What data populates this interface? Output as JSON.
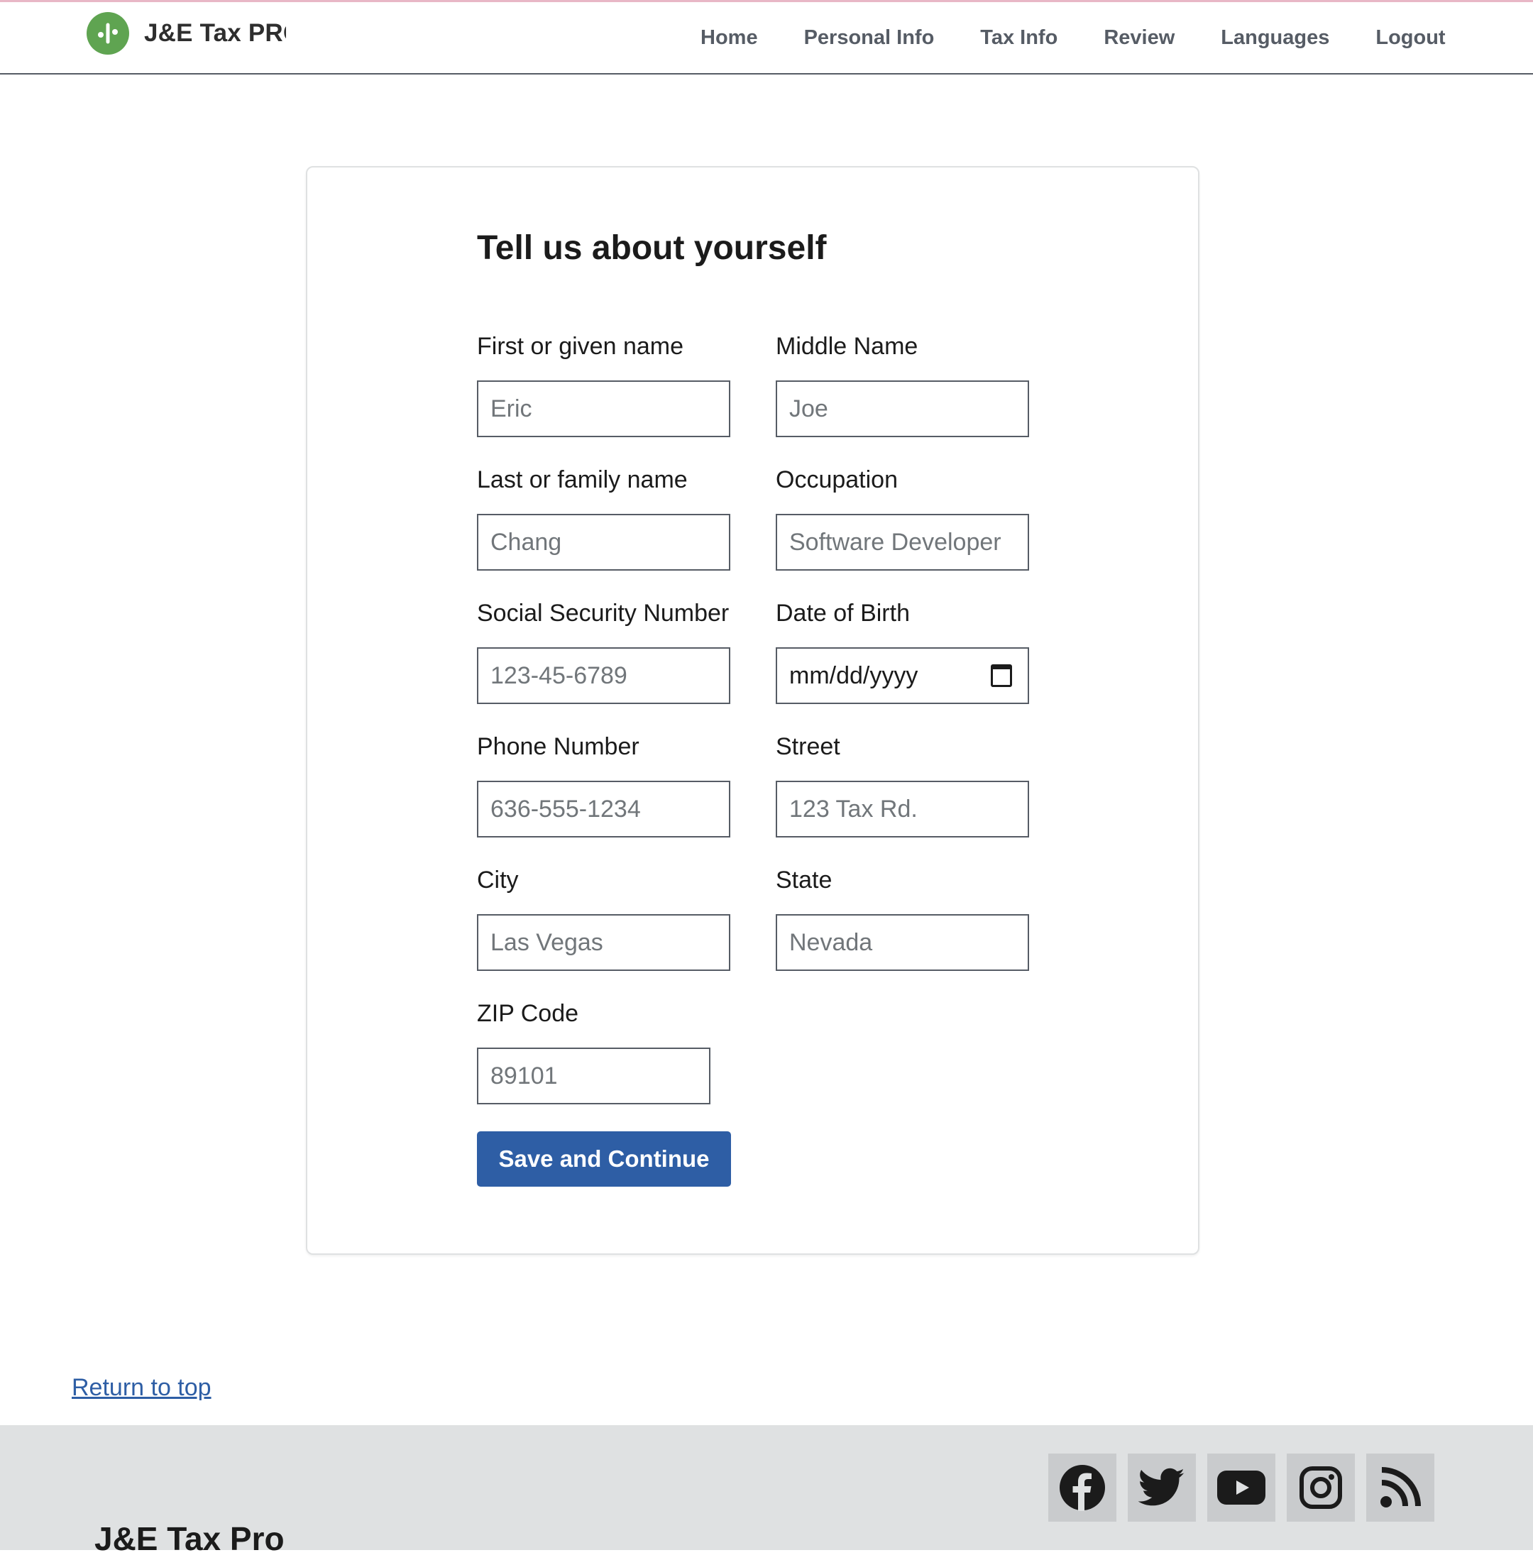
{
  "header": {
    "brand": "J&E Tax PRO",
    "nav": [
      "Home",
      "Personal Info",
      "Tax Info",
      "Review",
      "Languages",
      "Logout"
    ]
  },
  "form": {
    "title": "Tell us about yourself",
    "fields": {
      "first_name": {
        "label": "First or given name",
        "placeholder": "Eric"
      },
      "middle_name": {
        "label": "Middle Name",
        "placeholder": "Joe"
      },
      "last_name": {
        "label": "Last or family name",
        "placeholder": "Chang"
      },
      "occupation": {
        "label": "Occupation",
        "placeholder": "Software Developer"
      },
      "ssn": {
        "label": "Social Security Number",
        "placeholder": "123-45-6789"
      },
      "dob": {
        "label": "Date of Birth",
        "placeholder": "mm/dd/yyyy"
      },
      "phone": {
        "label": "Phone Number",
        "placeholder": "636-555-1234"
      },
      "street": {
        "label": "Street",
        "placeholder": "123 Tax Rd."
      },
      "city": {
        "label": "City",
        "placeholder": "Las Vegas"
      },
      "state": {
        "label": "State",
        "placeholder": "Nevada"
      },
      "zip": {
        "label": "ZIP Code",
        "placeholder": "89101"
      }
    },
    "submit_label": "Save and Continue"
  },
  "return_to_top": "Return to top",
  "footer": {
    "brand": "J&E Tax Pro",
    "social_icons": [
      "facebook-icon",
      "twitter-icon",
      "youtube-icon",
      "instagram-icon",
      "rss-icon"
    ]
  },
  "colors": {
    "primary": "#2e5ea5",
    "logo": "#5fa451",
    "nav_text": "#565c65",
    "footer_bg": "#dfe1e2"
  }
}
